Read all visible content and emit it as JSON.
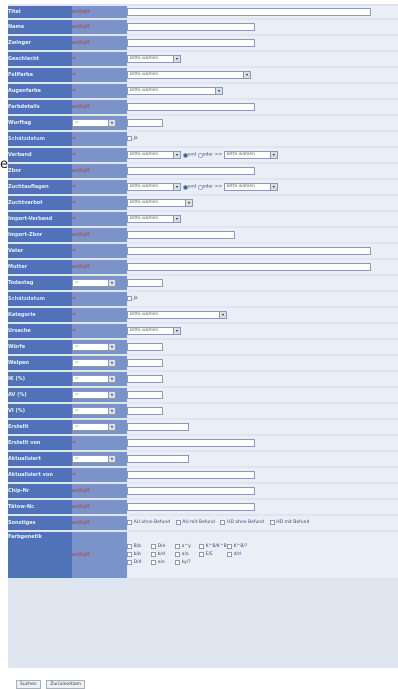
{
  "stray_text": "e",
  "op_contains": "enthält",
  "op_eq": "=",
  "colors": {
    "label_bg": "#4f72b8",
    "op_bg": "#7a93c8",
    "op_text": "#b43a44",
    "panel_bg": "#dfe5ef"
  },
  "select_placeholder": "Bitte wählen",
  "yes_label": "Ja",
  "and_label": "und",
  "or_label": "oder",
  "neq_label": "<>",
  "eq_select_value": "=",
  "labels": {
    "titel": "Titel",
    "name": "Name",
    "zwinger": "Zwinger",
    "geschlecht": "Geschlecht",
    "fellfarbe": "Fellfarbe",
    "augenfarbe": "Augenfarbe",
    "farbdetails": "Farbdetails",
    "wurftag": "Wurftag",
    "schaetzdatum1": "Schätzdatum",
    "verband": "Verband",
    "zbnr": "Zbnr",
    "zuchtauflagen": "Zuchtauflagen",
    "zuchtverbot": "Zuchtverbot",
    "import_verband": "Import-Verband",
    "import_zbnr": "Import-Zbnr",
    "vater": "Vater",
    "mutter": "Mutter",
    "todestag": "Todestag",
    "schaetzdatum2": "Schätzdatum",
    "kategorie": "Kategorie",
    "ursache": "Ursache",
    "wuerfe": "Würfe",
    "welpen": "Welpen",
    "ik": "IK (%)",
    "av": "AV (%)",
    "vi": "VI (%)",
    "erstellt": "Erstellt",
    "erstellt_von": "Erstellt von",
    "aktualisiert": "Aktualisiert",
    "aktualisiert_von": "Aktualisiert von",
    "chip_nr": "Chip-Nr",
    "taetow_nr": "Tätow-Nr.",
    "sonstiges": "Sonstiges",
    "farbgenetik": "Farbgenetik"
  },
  "sonstiges_options": [
    "AU ohne Befund",
    "AU mit Befund",
    "HD ohne Befund",
    "HD mit Befund"
  ],
  "genetics": [
    "B/b",
    "D/e",
    "a^y",
    "K^B/K^B",
    "K^B/?",
    "b/b",
    "b/d",
    "a/a",
    "E/E",
    "d/d",
    "D/d",
    "e/e",
    "ky/?"
  ],
  "buttons": {
    "search": "Suchen",
    "reset": "Zurücksetzen"
  }
}
